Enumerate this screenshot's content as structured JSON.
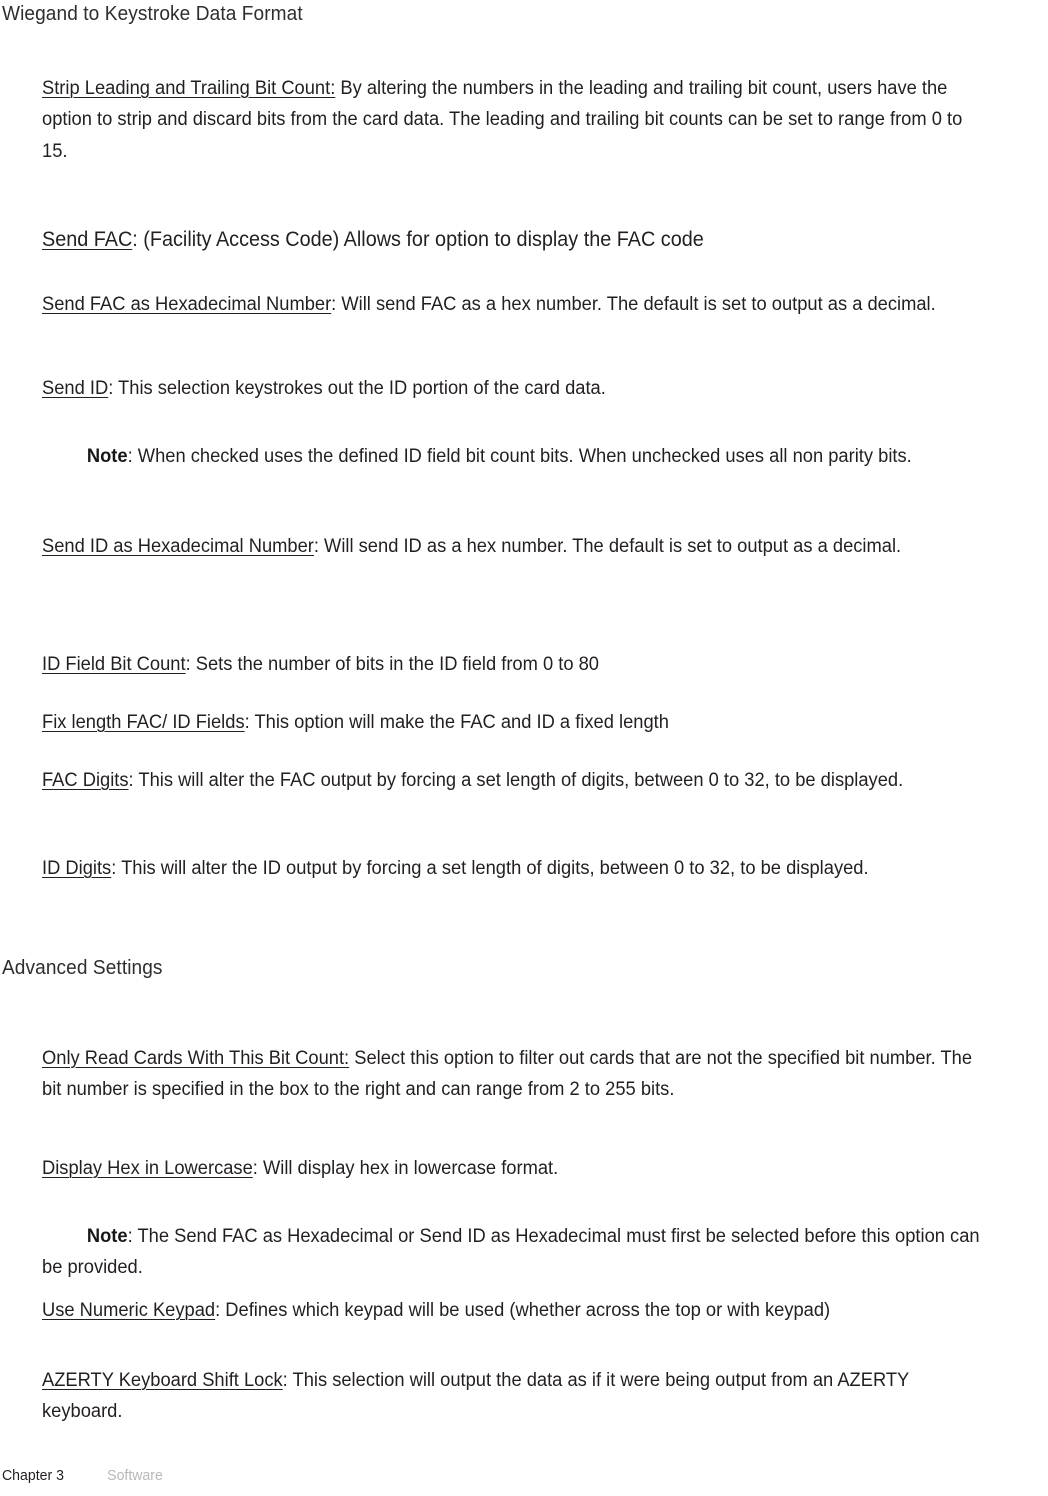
{
  "page": {
    "title": "Wiegand to Keystroke Data Format",
    "section_heading": "Advanced Settings",
    "text_color": "#231f20",
    "heading_color": "#2f2d2e",
    "footer_muted_color": "#b9b8b8",
    "background_color": "#ffffff"
  },
  "blocks": {
    "strip_bits": {
      "term": "Strip Leading and Trailing Bit Count:",
      "body": " By altering the numbers in the leading and trailing bit count, users have the option to strip and discard bits from the card data. The leading and trailing bit counts can be set to range from 0 to 15."
    },
    "send_fac": {
      "term": "Send FAC",
      "body": ": (Facility Access Code) Allows for option to display the FAC code"
    },
    "send_fac_hex": {
      "term": "Send FAC as Hexadecimal Number",
      "body": ": Will send FAC as a hex number. The default is set to output as a decimal."
    },
    "send_id": {
      "term": "Send ID",
      "body": ": This selection keystrokes out the ID portion of the card data."
    },
    "send_id_note": {
      "label": "Note",
      "body": ":  When checked uses the defined ID field bit count bits. When unchecked uses all non parity bits."
    },
    "send_id_hex": {
      "term": "Send ID as Hexadecimal Number",
      "body": ": Will send ID as a hex number. The default is set to output as a decimal."
    },
    "id_field_bit_count": {
      "term": "ID Field Bit Count",
      "body": ": Sets the number of bits in the ID field from 0 to 80"
    },
    "fix_length_fields": {
      "term": "Fix length FAC/ ID Fields",
      "body": ": This option will make the FAC and ID a fixed length"
    },
    "fac_digits": {
      "term": "FAC Digits",
      "body": ": This will alter the FAC output by forcing a set length of digits, between 0 to 32, to be displayed."
    },
    "id_digits": {
      "term": "ID Digits",
      "body": ": This will alter the ID output by forcing a set length of digits, between 0 to 32, to be displayed."
    },
    "only_read_cards": {
      "term": "Only Read Cards With This Bit Count:",
      "body": " Select this option to filter out cards that are not the specified bit number. The bit number is specified in the box to the right and can range from 2 to 255 bits."
    },
    "display_hex_lowercase": {
      "term": "Display Hex in Lowercase",
      "body": ": Will display hex in lowercase format."
    },
    "display_hex_note": {
      "label": "Note",
      "body": ": The Send FAC as Hexadecimal or Send ID as Hexadecimal must first be selected before this option can be provided."
    },
    "use_numeric_keypad": {
      "term": "Use Numeric Keypad",
      "body": ": Defines which keypad will be used (whether across the top or with keypad)"
    },
    "azerty_shift_lock": {
      "term": "AZERTY Keyboard Shift Lock",
      "body": ": This selection will output the data as if it were being output from an AZERTY keyboard."
    }
  },
  "footer": {
    "chapter": "Chapter 3",
    "section": "Software"
  }
}
